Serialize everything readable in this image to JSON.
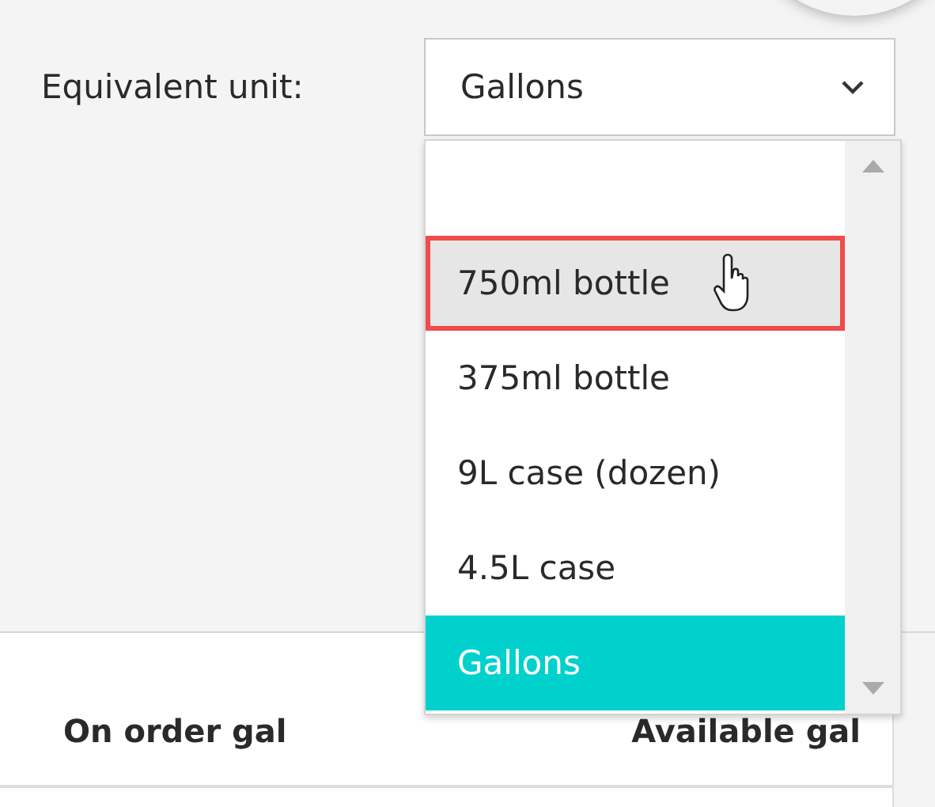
{
  "unit_field": {
    "label": "Equivalent unit:",
    "value": "Gallons",
    "expanded": true
  },
  "options": [
    {
      "kind": "blank",
      "selected": false,
      "hovered": false
    },
    {
      "kind": "text",
      "label": "750ml bottle",
      "selected": false,
      "hovered": true
    },
    {
      "kind": "text",
      "label": "375ml bottle",
      "selected": false,
      "hovered": false
    },
    {
      "kind": "text",
      "label": "9L case (dozen)",
      "selected": false,
      "hovered": false
    },
    {
      "kind": "text",
      "label": "4.5L case",
      "selected": false,
      "hovered": false
    },
    {
      "kind": "text",
      "label": "Gallons",
      "selected": true,
      "hovered": false
    }
  ],
  "table": {
    "columns": [
      "On order gal",
      "Available gal"
    ]
  }
}
